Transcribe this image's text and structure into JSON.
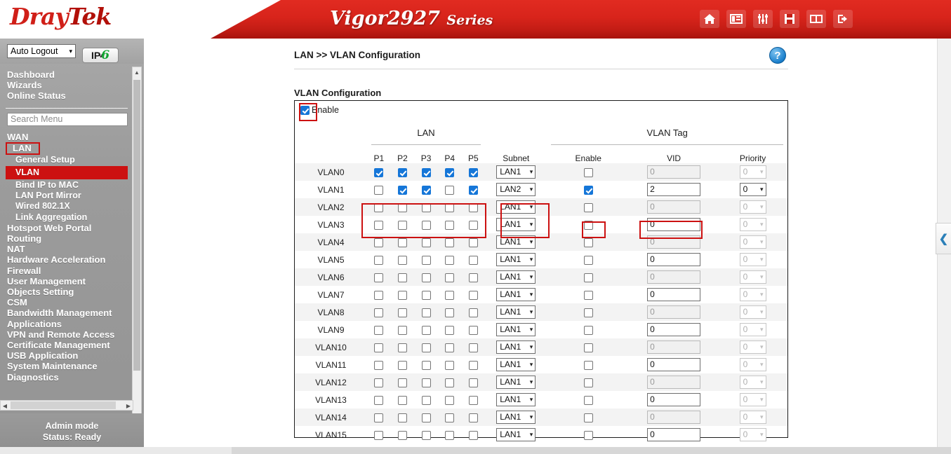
{
  "banner": {
    "logo_dray": "Dray",
    "logo_tek": "Tek",
    "model": "Vigor2927",
    "series": "Series",
    "icons": [
      {
        "name": "home-icon",
        "label": "Home"
      },
      {
        "name": "layout-icon",
        "label": "Dashboard Layout"
      },
      {
        "name": "sliders-icon",
        "label": "Quick Settings"
      },
      {
        "name": "save-icon",
        "label": "Save Configuration"
      },
      {
        "name": "book-icon",
        "label": "Manual"
      },
      {
        "name": "logout-icon",
        "label": "Logout"
      }
    ]
  },
  "sidebar": {
    "auto_logout_label": "Auto Logout",
    "auto_logout_caret": "▾",
    "ipv6_prefix": "IP",
    "ipv6_sub": "v",
    "ipv6_six": "6",
    "top_links": [
      "Dashboard",
      "Wizards",
      "Online Status"
    ],
    "search_placeholder": "Search Menu",
    "items": [
      {
        "label": "WAN",
        "level": "top",
        "state": "normal"
      },
      {
        "label": "LAN",
        "level": "top",
        "state": "boxed"
      },
      {
        "label": "General Setup",
        "level": "sub",
        "state": "normal"
      },
      {
        "label": "VLAN",
        "level": "sub",
        "state": "active"
      },
      {
        "label": "Bind IP to MAC",
        "level": "sub",
        "state": "normal"
      },
      {
        "label": "LAN Port Mirror",
        "level": "sub",
        "state": "normal"
      },
      {
        "label": "Wired 802.1X",
        "level": "sub",
        "state": "normal"
      },
      {
        "label": "Link Aggregation",
        "level": "sub",
        "state": "normal"
      },
      {
        "label": "Hotspot Web Portal",
        "level": "top",
        "state": "normal"
      },
      {
        "label": "Routing",
        "level": "top",
        "state": "normal"
      },
      {
        "label": "NAT",
        "level": "top",
        "state": "normal"
      },
      {
        "label": "Hardware Acceleration",
        "level": "top",
        "state": "normal"
      },
      {
        "label": "Firewall",
        "level": "top",
        "state": "normal"
      },
      {
        "label": "User Management",
        "level": "top",
        "state": "normal"
      },
      {
        "label": "Objects Setting",
        "level": "top",
        "state": "normal"
      },
      {
        "label": "CSM",
        "level": "top",
        "state": "normal"
      },
      {
        "label": "Bandwidth Management",
        "level": "top",
        "state": "normal"
      },
      {
        "label": "Applications",
        "level": "top",
        "state": "normal"
      },
      {
        "label": "VPN and Remote Access",
        "level": "top",
        "state": "normal"
      },
      {
        "label": "Certificate Management",
        "level": "top",
        "state": "normal"
      },
      {
        "label": "USB Application",
        "level": "top",
        "state": "normal"
      },
      {
        "label": "System Maintenance",
        "level": "top",
        "state": "normal"
      },
      {
        "label": "Diagnostics",
        "level": "top",
        "state": "normal"
      }
    ],
    "status_mode": "Admin mode",
    "status_ready": "Status: Ready"
  },
  "main": {
    "breadcrumb": "LAN >> VLAN Configuration",
    "help_glyph": "?",
    "section_title": "VLAN Configuration",
    "enable_label": "Enable",
    "enable_checked": true,
    "group_headers": {
      "lan": "LAN",
      "vlan_tag": "VLAN Tag"
    },
    "columns": {
      "p1": "P1",
      "p2": "P2",
      "p3": "P3",
      "p4": "P4",
      "p5": "P5",
      "subnet": "Subnet",
      "tag_enable": "Enable",
      "vid": "VID",
      "priority": "Priority"
    },
    "rows": [
      {
        "name": "VLAN0",
        "ports": [
          true,
          true,
          true,
          true,
          true
        ],
        "subnet": "LAN1",
        "tag_enable": false,
        "vid": "0",
        "vid_enabled": false,
        "priority": "0",
        "priority_enabled": false
      },
      {
        "name": "VLAN1",
        "ports": [
          false,
          true,
          true,
          false,
          true
        ],
        "subnet": "LAN2",
        "tag_enable": true,
        "vid": "2",
        "vid_enabled": true,
        "priority": "0",
        "priority_enabled": true
      },
      {
        "name": "VLAN2",
        "ports": [
          false,
          false,
          false,
          false,
          false
        ],
        "subnet": "LAN1",
        "tag_enable": false,
        "vid": "0",
        "vid_enabled": false,
        "priority": "0",
        "priority_enabled": false
      },
      {
        "name": "VLAN3",
        "ports": [
          false,
          false,
          false,
          false,
          false
        ],
        "subnet": "LAN1",
        "tag_enable": false,
        "vid": "0",
        "vid_enabled": true,
        "priority": "0",
        "priority_enabled": false
      },
      {
        "name": "VLAN4",
        "ports": [
          false,
          false,
          false,
          false,
          false
        ],
        "subnet": "LAN1",
        "tag_enable": false,
        "vid": "0",
        "vid_enabled": false,
        "priority": "0",
        "priority_enabled": false
      },
      {
        "name": "VLAN5",
        "ports": [
          false,
          false,
          false,
          false,
          false
        ],
        "subnet": "LAN1",
        "tag_enable": false,
        "vid": "0",
        "vid_enabled": true,
        "priority": "0",
        "priority_enabled": false
      },
      {
        "name": "VLAN6",
        "ports": [
          false,
          false,
          false,
          false,
          false
        ],
        "subnet": "LAN1",
        "tag_enable": false,
        "vid": "0",
        "vid_enabled": false,
        "priority": "0",
        "priority_enabled": false
      },
      {
        "name": "VLAN7",
        "ports": [
          false,
          false,
          false,
          false,
          false
        ],
        "subnet": "LAN1",
        "tag_enable": false,
        "vid": "0",
        "vid_enabled": true,
        "priority": "0",
        "priority_enabled": false
      },
      {
        "name": "VLAN8",
        "ports": [
          false,
          false,
          false,
          false,
          false
        ],
        "subnet": "LAN1",
        "tag_enable": false,
        "vid": "0",
        "vid_enabled": false,
        "priority": "0",
        "priority_enabled": false
      },
      {
        "name": "VLAN9",
        "ports": [
          false,
          false,
          false,
          false,
          false
        ],
        "subnet": "LAN1",
        "tag_enable": false,
        "vid": "0",
        "vid_enabled": true,
        "priority": "0",
        "priority_enabled": false
      },
      {
        "name": "VLAN10",
        "ports": [
          false,
          false,
          false,
          false,
          false
        ],
        "subnet": "LAN1",
        "tag_enable": false,
        "vid": "0",
        "vid_enabled": false,
        "priority": "0",
        "priority_enabled": false
      },
      {
        "name": "VLAN11",
        "ports": [
          false,
          false,
          false,
          false,
          false
        ],
        "subnet": "LAN1",
        "tag_enable": false,
        "vid": "0",
        "vid_enabled": true,
        "priority": "0",
        "priority_enabled": false
      },
      {
        "name": "VLAN12",
        "ports": [
          false,
          false,
          false,
          false,
          false
        ],
        "subnet": "LAN1",
        "tag_enable": false,
        "vid": "0",
        "vid_enabled": false,
        "priority": "0",
        "priority_enabled": false
      },
      {
        "name": "VLAN13",
        "ports": [
          false,
          false,
          false,
          false,
          false
        ],
        "subnet": "LAN1",
        "tag_enable": false,
        "vid": "0",
        "vid_enabled": true,
        "priority": "0",
        "priority_enabled": false
      },
      {
        "name": "VLAN14",
        "ports": [
          false,
          false,
          false,
          false,
          false
        ],
        "subnet": "LAN1",
        "tag_enable": false,
        "vid": "0",
        "vid_enabled": false,
        "priority": "0",
        "priority_enabled": false
      },
      {
        "name": "VLAN15",
        "ports": [
          false,
          false,
          false,
          false,
          false
        ],
        "subnet": "LAN1",
        "tag_enable": false,
        "vid": "0",
        "vid_enabled": true,
        "priority": "0",
        "priority_enabled": false
      }
    ],
    "select_caret": "▾",
    "collapse_tab_glyph": "❮"
  },
  "colors": {
    "brand_red": "#cc1111",
    "banner_red": "#d8241b",
    "checkbox_blue": "#1576d8",
    "accent_green": "#12a531",
    "help_blue": "#1a7fcc"
  }
}
